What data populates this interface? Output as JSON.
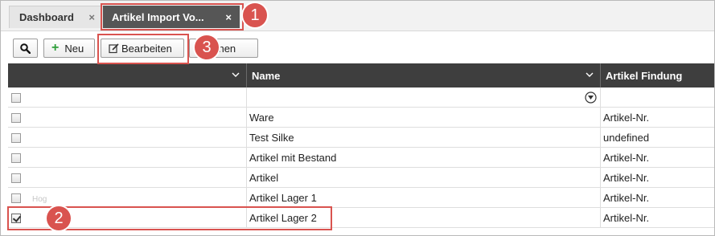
{
  "tabs": [
    {
      "label": "Dashboard",
      "close": "×"
    },
    {
      "label": "Artikel Import Vo...",
      "close": "×"
    }
  ],
  "toolbar": {
    "search_icon": "search-icon",
    "new_label": "Neu",
    "new_icon": "+",
    "edit_label": "Bearbeiten",
    "edit_icon": "edit-icon",
    "delete_label": "Löschen"
  },
  "grid": {
    "columns": [
      "",
      "Name",
      "Artikel Findung"
    ],
    "rows": [
      {
        "name": "Ware",
        "findung": "Artikel-Nr.",
        "checked": false
      },
      {
        "name": "Test Silke",
        "findung": "undefined",
        "checked": false
      },
      {
        "name": "Artikel mit Bestand",
        "findung": "Artikel-Nr.",
        "checked": false
      },
      {
        "name": "Artikel",
        "findung": "Artikel-Nr.",
        "checked": false
      },
      {
        "name": "Artikel Lager 1",
        "findung": "Artikel-Nr.",
        "checked": false
      },
      {
        "name": "Artikel Lager 2",
        "findung": "Artikel-Nr.",
        "checked": true
      }
    ],
    "ghost_text": "Hog"
  },
  "annotations": {
    "badge_1": "1",
    "badge_2": "2",
    "badge_3": "3",
    "color": "#d9534f"
  },
  "colors": {
    "active_tab": "#565656",
    "header": "#3e3e3e",
    "new_plus": "#2e9e3a"
  }
}
